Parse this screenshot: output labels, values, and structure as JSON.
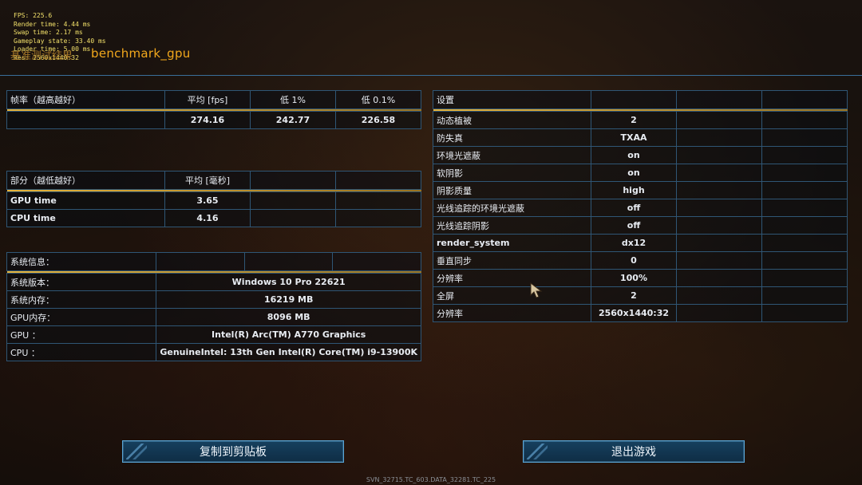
{
  "debug": [
    "FPS: 225.6",
    "Render time: 4.44 ms",
    "Swap time: 2.17 ms",
    "Gameplay state: 33.40 ms",
    "Loader time: 5.00 ms",
    "Res: 2560x1440:32"
  ],
  "header": {
    "prefix": "基准测试结果",
    "title": "benchmark_gpu"
  },
  "fps_table": {
    "header": [
      "帧率（越高越好）",
      "平均 [fps]",
      "低 1%",
      "低 0.1%"
    ],
    "row": [
      "",
      "274.16",
      "242.77",
      "226.58"
    ]
  },
  "parts_table": {
    "header": [
      "部分（越低越好）",
      "平均 [毫秒]",
      "",
      ""
    ],
    "rows": [
      [
        "GPU time",
        "3.65"
      ],
      [
        "CPU time",
        "4.16"
      ]
    ]
  },
  "sysinfo_table": {
    "header": "系统信息：",
    "rows": [
      [
        "系统版本：",
        "Windows 10 Pro 22621"
      ],
      [
        "系统内存：",
        "16219 MB"
      ],
      [
        "GPU内存：",
        "8096 MB"
      ],
      [
        "GPU ：",
        "Intel(R) Arc(TM) A770 Graphics"
      ],
      [
        "CPU ：",
        "GenuineIntel: 13th Gen Intel(R) Core(TM) i9-13900K"
      ]
    ]
  },
  "settings_table": {
    "header": "设置",
    "rows": [
      [
        "动态植被",
        "2"
      ],
      [
        "防失真",
        "TXAA"
      ],
      [
        "环境光遮蔽",
        "on"
      ],
      [
        "软阴影",
        "on"
      ],
      [
        "阴影质量",
        "high"
      ],
      [
        "光线追踪的环境光遮蔽",
        "off"
      ],
      [
        "光线追踪阴影",
        "off"
      ],
      [
        "render_system",
        "dx12"
      ],
      [
        "垂直同步",
        "0"
      ],
      [
        "分辨率",
        "100%"
      ],
      [
        "全屏",
        "2"
      ],
      [
        "分辨率",
        "2560x1440:32"
      ]
    ]
  },
  "buttons": {
    "copy": "复制到剪贴板",
    "exit": "退出游戏"
  },
  "footer": "SVN_32715.TC_603.DATA_32281.TC_225",
  "colors": {
    "accent": "#f2a81c",
    "border": "#2f5675",
    "button": "#16405f"
  }
}
